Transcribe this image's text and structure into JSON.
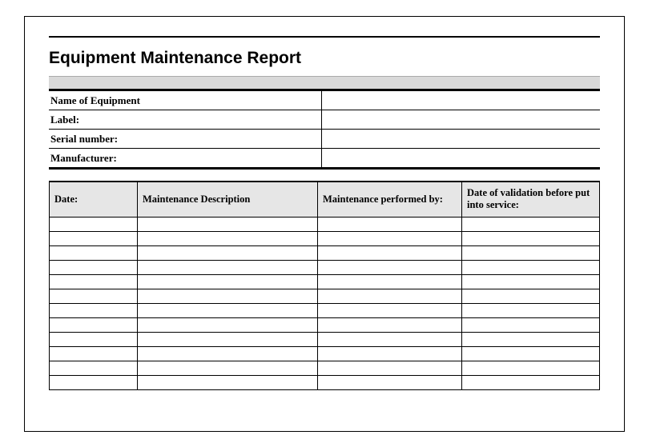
{
  "title": "Equipment Maintenance Report",
  "info": {
    "rows": [
      {
        "label": "Name of Equipment",
        "value": ""
      },
      {
        "label": "Label:",
        "value": ""
      },
      {
        "label": "Serial number:",
        "value": ""
      },
      {
        "label": "Manufacturer:",
        "value": ""
      }
    ]
  },
  "log": {
    "headers": {
      "date": "Date:",
      "description": "Maintenance Description",
      "performed_by": "Maintenance performed by:",
      "validation": "Date of validation before put into service:"
    },
    "rows": [
      {
        "date": "",
        "description": "",
        "performed_by": "",
        "validation": ""
      },
      {
        "date": "",
        "description": "",
        "performed_by": "",
        "validation": ""
      },
      {
        "date": "",
        "description": "",
        "performed_by": "",
        "validation": ""
      },
      {
        "date": "",
        "description": "",
        "performed_by": "",
        "validation": ""
      },
      {
        "date": "",
        "description": "",
        "performed_by": "",
        "validation": ""
      },
      {
        "date": "",
        "description": "",
        "performed_by": "",
        "validation": ""
      },
      {
        "date": "",
        "description": "",
        "performed_by": "",
        "validation": ""
      },
      {
        "date": "",
        "description": "",
        "performed_by": "",
        "validation": ""
      },
      {
        "date": "",
        "description": "",
        "performed_by": "",
        "validation": ""
      },
      {
        "date": "",
        "description": "",
        "performed_by": "",
        "validation": ""
      },
      {
        "date": "",
        "description": "",
        "performed_by": "",
        "validation": ""
      },
      {
        "date": "",
        "description": "",
        "performed_by": "",
        "validation": ""
      }
    ]
  }
}
